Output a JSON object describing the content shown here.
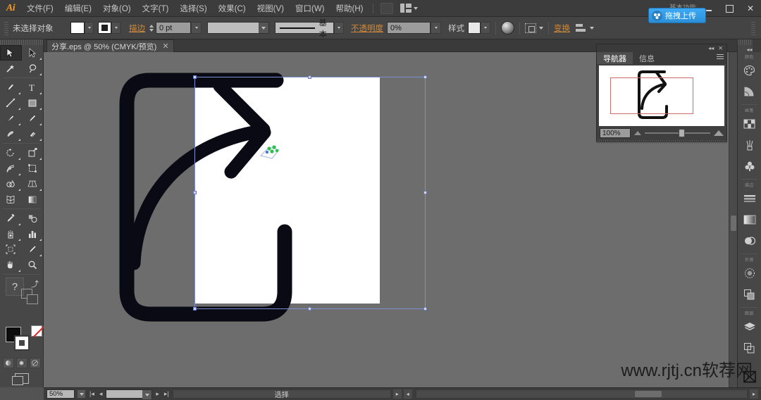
{
  "app": {
    "logo": "Ai",
    "workspace_label": "基本功能",
    "window_controls": {
      "minimize": "—",
      "maximize": "□",
      "close": "✕"
    }
  },
  "menubar": {
    "items": [
      {
        "label": "文件(F)"
      },
      {
        "label": "编辑(E)"
      },
      {
        "label": "对象(O)"
      },
      {
        "label": "文字(T)"
      },
      {
        "label": "选择(S)"
      },
      {
        "label": "效果(C)"
      },
      {
        "label": "视图(V)"
      },
      {
        "label": "窗口(W)"
      },
      {
        "label": "帮助(H)"
      }
    ]
  },
  "upload_pill": {
    "label": "拖拽上传"
  },
  "controlbar": {
    "selection_status": "未选择对象",
    "fill_color": "#ffffff",
    "stroke_color": "#ffffff",
    "stroke_label": "描边",
    "stroke_weight": "0 pt",
    "brush_definition": "",
    "profile_label": "基本",
    "opacity_label": "不透明度",
    "opacity_value": "0%",
    "style_label": "样式",
    "transform_label": "变换",
    "align_label": "对齐"
  },
  "document_tab": {
    "label": "分享.eps @ 50% (CMYK/预览)",
    "close": "✕"
  },
  "toolbar": {
    "tools": [
      {
        "name": "selection-tool",
        "glyph": "selection",
        "active": true
      },
      {
        "name": "direct-selection-tool",
        "glyph": "direct-selection",
        "active": false
      },
      {
        "name": "magic-wand-tool",
        "glyph": "magic-wand",
        "active": false
      },
      {
        "name": "lasso-tool",
        "glyph": "lasso",
        "active": false
      },
      {
        "name": "pen-tool",
        "glyph": "pen",
        "active": false
      },
      {
        "name": "type-tool",
        "glyph": "type",
        "active": false
      },
      {
        "name": "line-segment-tool",
        "glyph": "line",
        "active": false
      },
      {
        "name": "rectangle-tool",
        "glyph": "rectangle",
        "active": false
      },
      {
        "name": "paintbrush-tool",
        "glyph": "paintbrush",
        "active": false
      },
      {
        "name": "pencil-tool",
        "glyph": "pencil",
        "active": false
      },
      {
        "name": "blob-brush-tool",
        "glyph": "blob-brush",
        "active": false
      },
      {
        "name": "eraser-tool",
        "glyph": "eraser",
        "active": false
      },
      {
        "name": "rotate-tool",
        "glyph": "rotate",
        "active": false
      },
      {
        "name": "scale-tool",
        "glyph": "scale",
        "active": false
      },
      {
        "name": "width-tool",
        "glyph": "width",
        "active": false
      },
      {
        "name": "free-transform-tool",
        "glyph": "free-transform",
        "active": false
      },
      {
        "name": "shape-builder-tool",
        "glyph": "shape-builder",
        "active": false
      },
      {
        "name": "perspective-grid-tool",
        "glyph": "perspective-grid",
        "active": false
      },
      {
        "name": "mesh-tool",
        "glyph": "mesh",
        "active": false
      },
      {
        "name": "gradient-tool",
        "glyph": "gradient",
        "active": false
      },
      {
        "name": "eyedropper-tool",
        "glyph": "eyedropper",
        "active": false
      },
      {
        "name": "blend-tool",
        "glyph": "blend",
        "active": false
      },
      {
        "name": "symbol-sprayer-tool",
        "glyph": "symbol-sprayer",
        "active": false
      },
      {
        "name": "column-graph-tool",
        "glyph": "column-graph",
        "active": false
      },
      {
        "name": "artboard-tool",
        "glyph": "artboard",
        "active": false
      },
      {
        "name": "slice-tool",
        "glyph": "slice",
        "active": false
      },
      {
        "name": "hand-tool",
        "glyph": "hand",
        "active": false
      },
      {
        "name": "zoom-tool",
        "glyph": "zoom",
        "active": false
      }
    ],
    "help_glyph": "?",
    "fill_color": "#0d0d0d",
    "stroke_color": "#ffffff"
  },
  "navigator": {
    "tabs": [
      {
        "label": "导航器",
        "selected": true
      },
      {
        "label": "信息",
        "selected": false
      }
    ],
    "zoom_value": "100%",
    "collapse_glyph": "◂◂",
    "close_glyph": "✕"
  },
  "rightdock": {
    "groups": [
      {
        "label": "颜色",
        "items": [
          {
            "name": "color-panel-icon",
            "glyph": "palette"
          },
          {
            "name": "color-guide-panel-icon",
            "glyph": "color-guide"
          }
        ]
      },
      {
        "label": "画笔",
        "items": [
          {
            "name": "swatches-panel-icon",
            "glyph": "swatches"
          },
          {
            "name": "brushes-panel-icon",
            "glyph": "brushes"
          },
          {
            "name": "symbols-panel-icon",
            "glyph": "symbols"
          }
        ]
      },
      {
        "label": "描边",
        "items": [
          {
            "name": "stroke-panel-icon",
            "glyph": "stroke"
          },
          {
            "name": "gradient-panel-icon",
            "glyph": "gradient"
          },
          {
            "name": "transparency-panel-icon",
            "glyph": "transparency"
          }
        ]
      },
      {
        "label": "外观",
        "items": [
          {
            "name": "appearance-panel-icon",
            "glyph": "appearance"
          },
          {
            "name": "graphic-styles-panel-icon",
            "glyph": "graphic-styles"
          }
        ]
      },
      {
        "label": "图层",
        "items": [
          {
            "name": "layers-panel-icon",
            "glyph": "layers"
          },
          {
            "name": "artboards-panel-icon",
            "glyph": "artboards"
          }
        ]
      }
    ],
    "bottom_item": {
      "name": "links-panel-icon",
      "glyph": "links"
    }
  },
  "statusbar": {
    "zoom_value": "50%",
    "artboard_value": "",
    "status_text": "选择",
    "first_glyph": "|◂",
    "prev_glyph": "◂",
    "next_glyph": "▸",
    "last_glyph": "▸|"
  },
  "artwork": {
    "description": "share-arrow-icon",
    "stroke_color": "#0a0a14",
    "artboard_color": "#ffffff"
  },
  "watermark": {
    "text": "www.rjtj.cn软荐网"
  }
}
